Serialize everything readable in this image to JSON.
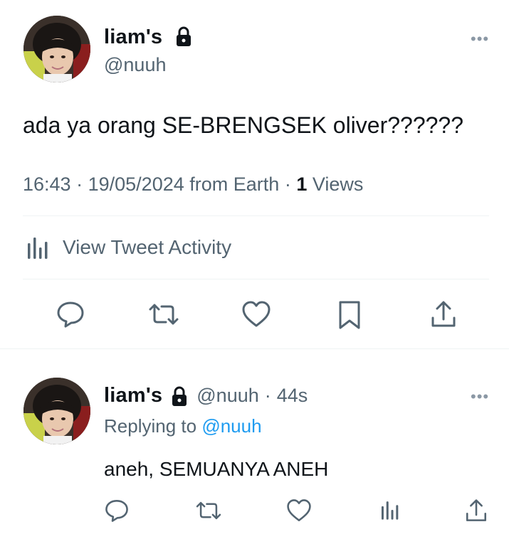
{
  "main_tweet": {
    "author_name": "liam's",
    "author_handle": "@nuuh",
    "text": "ada ya orang SE-BRENGSEK oliver??????",
    "time": "16:43",
    "date": "19/05/2024",
    "source": "from Earth",
    "views_count": "1",
    "views_label": "Views",
    "separator": "·",
    "activity_label": "View Tweet Activity",
    "more_label": "•••"
  },
  "reply": {
    "author_name": "liam's",
    "author_handle": "@nuuh",
    "time": "44s",
    "separator": "·",
    "replying_prefix": "Replying to",
    "replying_handle": "@nuuh",
    "text": "aneh, SEMUANYA ANEH",
    "more_label": "•••"
  },
  "icons": {
    "lock": "lock-icon",
    "reply": "reply-icon",
    "retweet": "retweet-icon",
    "like": "like-icon",
    "bookmark": "bookmark-icon",
    "share": "share-icon",
    "analytics": "analytics-icon"
  },
  "colors": {
    "text_primary": "#0f1419",
    "text_secondary": "#536471",
    "link": "#1d9bf0",
    "divider": "#eff3f4"
  }
}
